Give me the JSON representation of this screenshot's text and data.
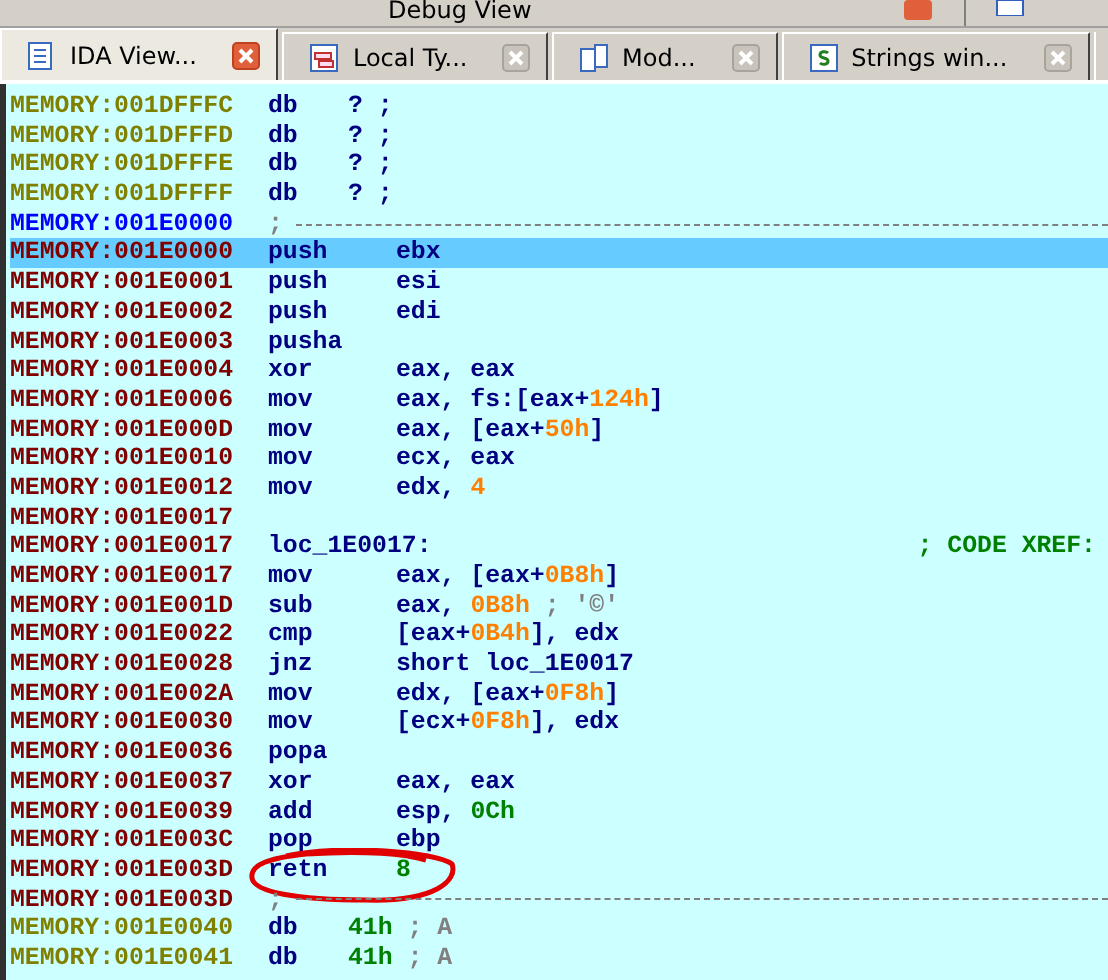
{
  "window": {
    "title": "Debug View"
  },
  "tabs": [
    {
      "label": "IDA View...",
      "kind": "listing",
      "selected": true
    },
    {
      "label": "Local Ty...",
      "kind": "types",
      "selected": false
    },
    {
      "label": "Mod...",
      "kind": "modules",
      "selected": false
    },
    {
      "label": "Strings win...",
      "kind": "strings",
      "selected": false
    }
  ],
  "listing": {
    "lines": [
      {
        "address": "MEMORY:001DFFFC",
        "kind": "data",
        "selected": false,
        "mnemonic": "db",
        "operands": [
          {
            "text": "?",
            "kind": "text"
          },
          {
            "text": " ;",
            "kind": "text"
          }
        ]
      },
      {
        "address": "MEMORY:001DFFFD",
        "kind": "data",
        "selected": false,
        "mnemonic": "db",
        "operands": [
          {
            "text": "?",
            "kind": "text"
          },
          {
            "text": " ;",
            "kind": "text"
          }
        ]
      },
      {
        "address": "MEMORY:001DFFFE",
        "kind": "data",
        "selected": false,
        "mnemonic": "db",
        "operands": [
          {
            "text": "?",
            "kind": "text"
          },
          {
            "text": " ;",
            "kind": "text"
          }
        ]
      },
      {
        "address": "MEMORY:001DFFFF",
        "kind": "data",
        "selected": false,
        "mnemonic": "db",
        "operands": [
          {
            "text": "?",
            "kind": "text"
          },
          {
            "text": " ;",
            "kind": "text"
          }
        ]
      },
      {
        "address": "MEMORY:001E0000",
        "kind": "cursor",
        "selected": false,
        "mnemonic": ";"
      },
      {
        "address": "MEMORY:001E0000",
        "kind": "code",
        "selected": true,
        "mnemonic": "push",
        "operands": [
          {
            "text": "ebx",
            "kind": "text"
          }
        ]
      },
      {
        "address": "MEMORY:001E0001",
        "kind": "code",
        "selected": false,
        "mnemonic": "push",
        "operands": [
          {
            "text": "esi",
            "kind": "text"
          }
        ]
      },
      {
        "address": "MEMORY:001E0002",
        "kind": "code",
        "selected": false,
        "mnemonic": "push",
        "operands": [
          {
            "text": "edi",
            "kind": "text"
          }
        ]
      },
      {
        "address": "MEMORY:001E0003",
        "kind": "code",
        "selected": false,
        "mnemonic": "pusha"
      },
      {
        "address": "MEMORY:001E0004",
        "kind": "code",
        "selected": false,
        "mnemonic": "xor",
        "operands": [
          {
            "text": "eax, eax",
            "kind": "text"
          }
        ]
      },
      {
        "address": "MEMORY:001E0006",
        "kind": "code",
        "selected": false,
        "mnemonic": "mov",
        "operands": [
          {
            "text": "eax, fs:[eax+",
            "kind": "text"
          },
          {
            "text": "124h",
            "kind": "number"
          },
          {
            "text": "]",
            "kind": "text"
          }
        ]
      },
      {
        "address": "MEMORY:001E000D",
        "kind": "code",
        "selected": false,
        "mnemonic": "mov",
        "operands": [
          {
            "text": "eax, [eax+",
            "kind": "text"
          },
          {
            "text": "50h",
            "kind": "number"
          },
          {
            "text": "]",
            "kind": "text"
          }
        ]
      },
      {
        "address": "MEMORY:001E0010",
        "kind": "code",
        "selected": false,
        "mnemonic": "mov",
        "operands": [
          {
            "text": "ecx, eax",
            "kind": "text"
          }
        ]
      },
      {
        "address": "MEMORY:001E0012",
        "kind": "code",
        "selected": false,
        "mnemonic": "mov",
        "operands": [
          {
            "text": "edx, ",
            "kind": "text"
          },
          {
            "text": "4",
            "kind": "number"
          }
        ]
      },
      {
        "address": "MEMORY:001E0017",
        "kind": "blank",
        "selected": false
      },
      {
        "address": "MEMORY:001E0017",
        "kind": "label",
        "selected": false,
        "mnemonic": "loc_1E0017:",
        "comment": "; CODE XREF:"
      },
      {
        "address": "MEMORY:001E0017",
        "kind": "code",
        "selected": false,
        "mnemonic": "mov",
        "operands": [
          {
            "text": "eax, [eax+",
            "kind": "text"
          },
          {
            "text": "0B8h",
            "kind": "number"
          },
          {
            "text": "]",
            "kind": "text"
          }
        ]
      },
      {
        "address": "MEMORY:001E001D",
        "kind": "code",
        "selected": false,
        "mnemonic": "sub",
        "operands": [
          {
            "text": "eax, ",
            "kind": "text"
          },
          {
            "text": "0B8h",
            "kind": "number"
          },
          {
            "text": " ; '©'",
            "kind": "comment"
          }
        ]
      },
      {
        "address": "MEMORY:001E0022",
        "kind": "code",
        "selected": false,
        "mnemonic": "cmp",
        "operands": [
          {
            "text": "[eax+",
            "kind": "text"
          },
          {
            "text": "0B4h",
            "kind": "number"
          },
          {
            "text": "], edx",
            "kind": "text"
          }
        ]
      },
      {
        "address": "MEMORY:001E0028",
        "kind": "code",
        "selected": false,
        "mnemonic": "jnz",
        "operands": [
          {
            "text": "short loc_1E0017",
            "kind": "text"
          }
        ]
      },
      {
        "address": "MEMORY:001E002A",
        "kind": "code",
        "selected": false,
        "mnemonic": "mov",
        "operands": [
          {
            "text": "edx, [eax+",
            "kind": "text"
          },
          {
            "text": "0F8h",
            "kind": "number"
          },
          {
            "text": "]",
            "kind": "text"
          }
        ]
      },
      {
        "address": "MEMORY:001E0030",
        "kind": "code",
        "selected": false,
        "mnemonic": "mov",
        "operands": [
          {
            "text": "[ecx+",
            "kind": "text"
          },
          {
            "text": "0F8h",
            "kind": "number"
          },
          {
            "text": "], edx",
            "kind": "text"
          }
        ]
      },
      {
        "address": "MEMORY:001E0036",
        "kind": "code",
        "selected": false,
        "mnemonic": "popa"
      },
      {
        "address": "MEMORY:001E0037",
        "kind": "code",
        "selected": false,
        "mnemonic": "xor",
        "operands": [
          {
            "text": "eax, eax",
            "kind": "text"
          }
        ]
      },
      {
        "address": "MEMORY:001E0039",
        "kind": "code",
        "selected": false,
        "mnemonic": "add",
        "operands": [
          {
            "text": "esp, ",
            "kind": "text"
          },
          {
            "text": "0Ch",
            "kind": "decimal"
          }
        ]
      },
      {
        "address": "MEMORY:001E003C",
        "kind": "code",
        "selected": false,
        "mnemonic": "pop",
        "operands": [
          {
            "text": "ebp",
            "kind": "text"
          }
        ]
      },
      {
        "address": "MEMORY:001E003D",
        "kind": "code",
        "selected": false,
        "marked": true,
        "mnemonic": "retn",
        "operands": [
          {
            "text": "8",
            "kind": "decimal"
          }
        ]
      },
      {
        "address": "MEMORY:001E003D",
        "kind": "separator",
        "selected": false,
        "mnemonic": ";"
      },
      {
        "address": "MEMORY:001E0040",
        "kind": "data",
        "selected": false,
        "mnemonic": "db",
        "operands": [
          {
            "text": "41h",
            "kind": "decimal"
          },
          {
            "text": " ; A",
            "kind": "comment"
          }
        ]
      },
      {
        "address": "MEMORY:001E0041",
        "kind": "data",
        "selected": false,
        "mnemonic": "db",
        "operands": [
          {
            "text": "41h",
            "kind": "decimal"
          },
          {
            "text": " ; A",
            "kind": "comment"
          }
        ]
      }
    ]
  }
}
